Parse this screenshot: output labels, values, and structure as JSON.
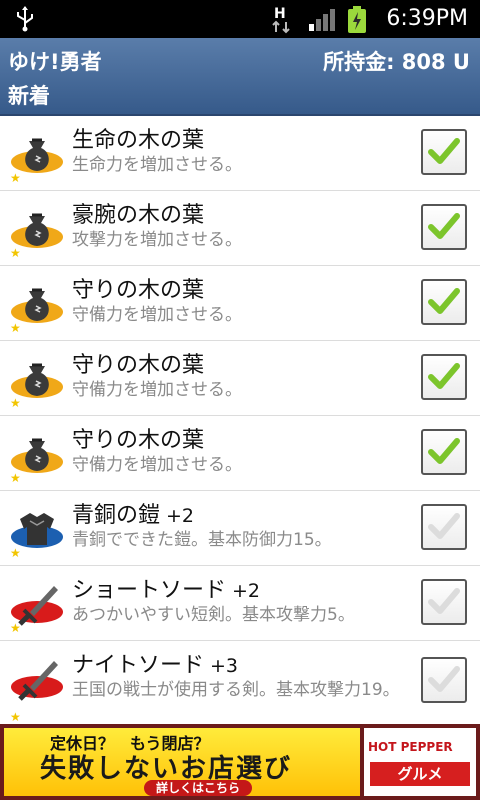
{
  "status_bar": {
    "time": "6:39PM",
    "network_label": "H"
  },
  "header": {
    "app_title": "ゆけ!勇者",
    "money": "所持金: 808 U",
    "subtitle": "新着"
  },
  "items": [
    {
      "name": "生命の木の葉",
      "plus": "",
      "desc": "生命力を増加させる。",
      "icon": "bag-icon",
      "checked": true
    },
    {
      "name": "豪腕の木の葉",
      "plus": "",
      "desc": "攻撃力を増加させる。",
      "icon": "bag-icon",
      "checked": true
    },
    {
      "name": "守りの木の葉",
      "plus": "",
      "desc": "守備力を増加させる。",
      "icon": "bag-icon",
      "checked": true
    },
    {
      "name": "守りの木の葉",
      "plus": "",
      "desc": "守備力を増加させる。",
      "icon": "bag-icon",
      "checked": true
    },
    {
      "name": "守りの木の葉",
      "plus": "",
      "desc": "守備力を増加させる。",
      "icon": "bag-icon",
      "checked": true
    },
    {
      "name": "青銅の鎧",
      "plus": "+2",
      "desc": "青銅でできた鎧。基本防御力15。",
      "icon": "armor-icon",
      "checked": false
    },
    {
      "name": "ショートソード",
      "plus": "+2",
      "desc": "あつかいやすい短剣。基本攻撃力5。",
      "icon": "sword-icon",
      "checked": false
    },
    {
      "name": "ナイトソード",
      "plus": "+3",
      "desc": "王国の戦士が使用する剣。基本攻撃力19。",
      "icon": "sword-icon",
      "checked": false
    }
  ],
  "ad": {
    "line1": "定休日？　もう閉店？",
    "line2": "失敗しないお店選び",
    "line3": "詳しくはこちら",
    "brand": "HOT PEPPER",
    "brand_sub": "グルメ"
  },
  "colors": {
    "header_bg": "#4a6e9e",
    "check_green": "#7cc52c",
    "ad_yellow": "#ffd600"
  }
}
